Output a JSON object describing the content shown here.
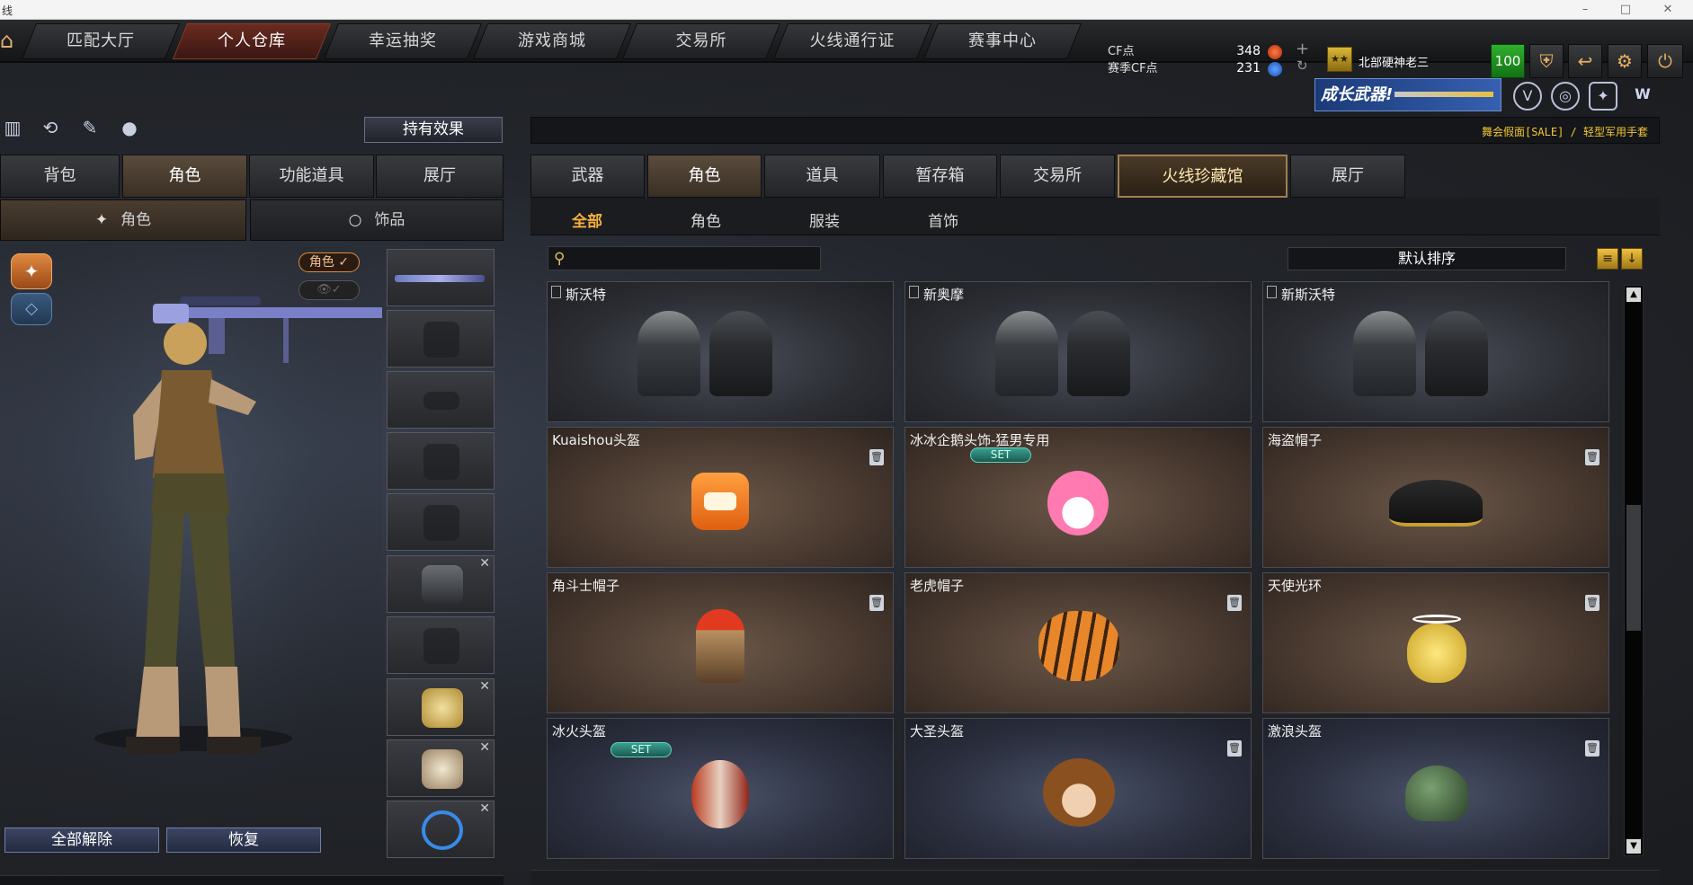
{
  "window": {
    "title": "线"
  },
  "nav": {
    "tabs": [
      "匹配大厅",
      "个人仓库",
      "幸运抽奖",
      "游戏商城",
      "交易所",
      "火线通行证",
      "赛事中心"
    ],
    "active_tab": "个人仓库"
  },
  "currency": {
    "cf_label": "CF点",
    "cf_value": "348",
    "season_label": "赛季CF点",
    "season_value": "231"
  },
  "user": {
    "name": "北部硬神老三",
    "level": "100",
    "rank_icon": "rank-badge-icon"
  },
  "banner": {
    "text": "成长武器!"
  },
  "ticker": {
    "text": "舞会假面[SALE] / 轻型军用手套"
  },
  "left": {
    "effect_button": "持有效果",
    "tabs": [
      "背包",
      "角色",
      "功能道具",
      "展厅"
    ],
    "active_tab": "角色",
    "subtabs": [
      "角色",
      "饰品"
    ],
    "active_subtab": "角色",
    "role_pill": "角色 ✓",
    "unequip_all": "全部解除",
    "restore": "恢复"
  },
  "right": {
    "tabs": [
      "武器",
      "角色",
      "道具",
      "暂存箱",
      "交易所",
      "火线珍藏馆",
      "展厅"
    ],
    "active_tab": "角色",
    "highlight_tab": "火线珍藏馆",
    "subtabs": [
      "全部",
      "角色",
      "服装",
      "首饰"
    ],
    "active_subtab": "全部",
    "search_placeholder": "",
    "sort_label": "默认排序"
  },
  "items": [
    {
      "name": "斯沃特",
      "style": "dark",
      "bookmark": true,
      "set": false,
      "deletable": false,
      "kind": "soldiers"
    },
    {
      "name": "新奥摩",
      "style": "dark",
      "bookmark": true,
      "set": false,
      "deletable": false,
      "kind": "soldiers"
    },
    {
      "name": "新斯沃特",
      "style": "dark",
      "bookmark": true,
      "set": false,
      "deletable": false,
      "kind": "soldiers"
    },
    {
      "name": "Kuaishou头盔",
      "style": "brown",
      "bookmark": false,
      "set": false,
      "deletable": true,
      "kind": "kuaishou"
    },
    {
      "name": "冰冰企鹅头饰-猛男专用",
      "style": "brown",
      "bookmark": false,
      "set": true,
      "deletable": false,
      "kind": "penguin"
    },
    {
      "name": "海盗帽子",
      "style": "brown",
      "bookmark": false,
      "set": false,
      "deletable": true,
      "kind": "pirate"
    },
    {
      "name": "角斗士帽子",
      "style": "brown",
      "bookmark": false,
      "set": false,
      "deletable": true,
      "kind": "gladiator"
    },
    {
      "name": "老虎帽子",
      "style": "brown",
      "bookmark": false,
      "set": false,
      "deletable": true,
      "kind": "tiger"
    },
    {
      "name": "天使光环",
      "style": "brown",
      "bookmark": false,
      "set": false,
      "deletable": true,
      "kind": "halo"
    },
    {
      "name": "冰火头盔",
      "style": "navy",
      "bookmark": false,
      "set": true,
      "deletable": false,
      "kind": "icefire"
    },
    {
      "name": "大圣头盔",
      "style": "navy",
      "bookmark": false,
      "set": false,
      "deletable": true,
      "kind": "monkey"
    },
    {
      "name": "激浪头盔",
      "style": "navy",
      "bookmark": false,
      "set": false,
      "deletable": true,
      "kind": "wave"
    }
  ],
  "set_label": "SET",
  "colors": {
    "accent": "#f5b040",
    "active_nav": "#6a2a20",
    "level_badge": "#2fb02f"
  }
}
